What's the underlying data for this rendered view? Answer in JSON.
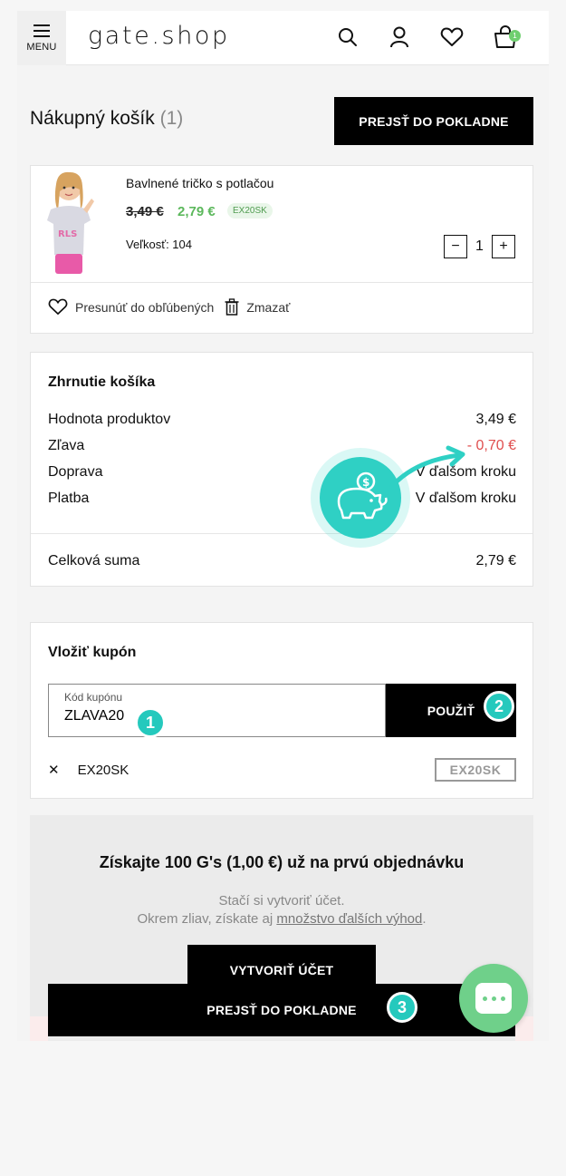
{
  "header": {
    "menu_label": "MENU",
    "logo": "gate.shop",
    "cart_count": "1"
  },
  "cart": {
    "title": "Nákupný košík",
    "count": "(1)",
    "checkout_label": "PREJSŤ DO POKLADNE"
  },
  "product": {
    "name": "Bavlnené tričko s potlačou",
    "old_price": "3,49 €",
    "new_price": "2,79 €",
    "promo_code": "EX20SK",
    "size": "Veľkosť: 104",
    "quantity": "1",
    "qty_minus": "−",
    "qty_plus": "+",
    "move_to_favorites": "Presunúť do obľúbených",
    "delete": "Zmazať"
  },
  "summary": {
    "title": "Zhrnutie košíka",
    "rows": [
      {
        "label": "Hodnota produktov",
        "value": "3,49 €"
      },
      {
        "label": "Zľava",
        "value": "- 0,70 €"
      },
      {
        "label": "Doprava",
        "value": "V ďalšom kroku"
      },
      {
        "label": "Platba",
        "value": "V ďalšom kroku"
      }
    ],
    "total_label": "Celková suma",
    "total_value": "2,79 €"
  },
  "coupon": {
    "title": "Vložiť kupón",
    "field_label": "Kód kupónu",
    "field_value": "ZLAVA20",
    "apply_label": "POUŽIŤ",
    "applied_code": "EX20SK",
    "applied_tag": "EX20SK",
    "remove_symbol": "✕"
  },
  "steps": [
    "1",
    "2",
    "3"
  ],
  "promo": {
    "title": "Získajte 100 G's (1,00 €) už na prvú objednávku",
    "line1": "Stačí si vytvoriť účet.",
    "line2_prefix": "Okrem zliav, získate aj ",
    "line2_link": "množstvo ďalších výhod",
    "line2_suffix": ".",
    "create_account": "VYTVORIŤ ÚČET",
    "checkout_label": "PREJSŤ DO POKLADNE"
  },
  "colors": {
    "accent_green": "#5cb85c",
    "discount_red": "#e04e4e",
    "step_teal": "#25c9bd",
    "chat_green": "#6fd08a"
  },
  "icons": [
    "menu-icon",
    "search-icon",
    "user-icon",
    "heart-icon",
    "cart-icon",
    "trash-icon",
    "piggy-bank-icon",
    "chat-icon"
  ]
}
